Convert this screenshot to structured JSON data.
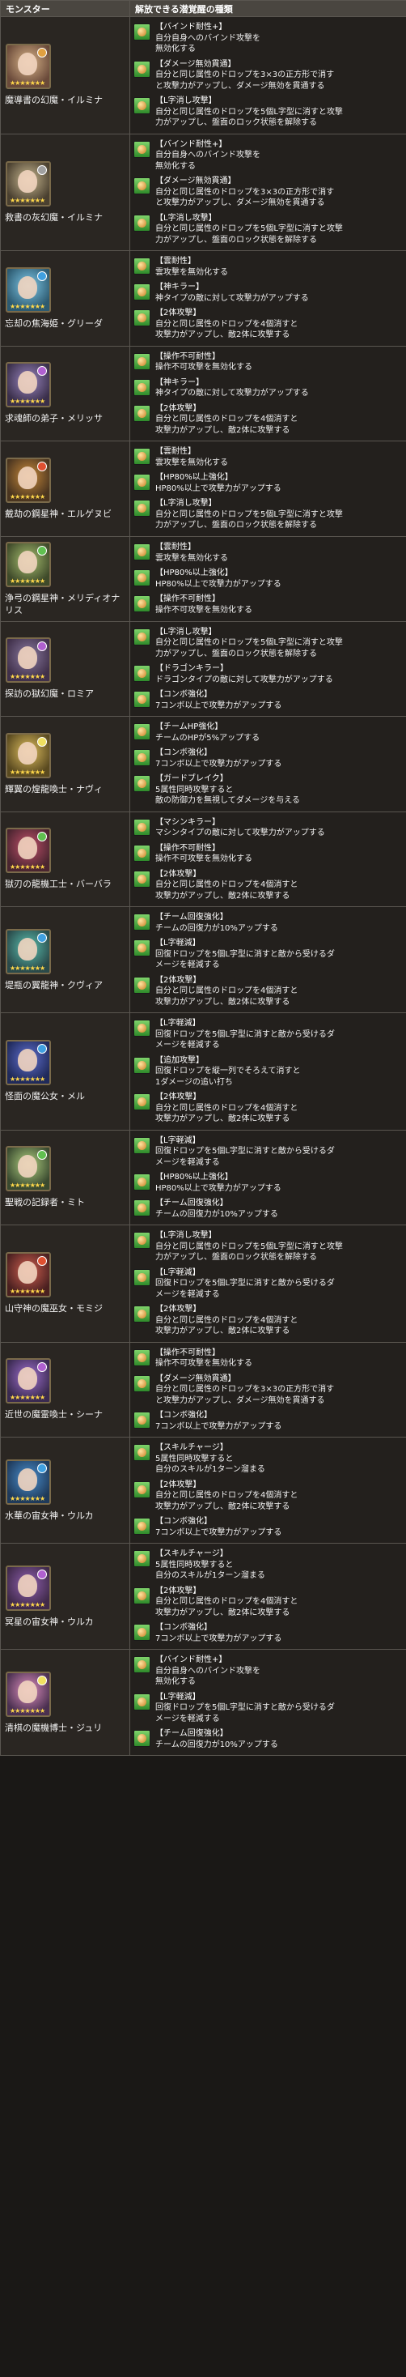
{
  "header": {
    "col_monster": "モンスター",
    "col_skills": "解放できる潜覚醒の種類"
  },
  "colors": {
    "header_bg": "#4a4640",
    "border": "#5a5650",
    "row_bg": "#23201d",
    "icon_green": "#3e9a34"
  },
  "rows": [
    {
      "name": "魔導書の幻魔・イルミナ",
      "icon": "awakening-green-icon",
      "skills": [
        {
          "title": "【バインド耐性+】",
          "lines": [
            "自分自身へのバインド攻撃を",
            "無効化する"
          ]
        },
        {
          "title": "【ダメージ無効貫通】",
          "lines": [
            "自分と同じ属性のドロップを3×3の正方形で消す",
            "と攻撃力がアップし、ダメージ無効を貫通する"
          ]
        },
        {
          "title": "【L字消し攻撃】",
          "lines": [
            "自分と同じ属性のドロップを5個L字型に消すと攻撃",
            "力がアップし、盤面のロック状態を解除する"
          ]
        }
      ]
    },
    {
      "name": "救書の灰幻魔・イルミナ",
      "icon": "awakening-green-icon",
      "skills": [
        {
          "title": "【バインド耐性+】",
          "lines": [
            "自分自身へのバインド攻撃を",
            "無効化する"
          ]
        },
        {
          "title": "【ダメージ無効貫通】",
          "lines": [
            "自分と同じ属性のドロップを3×3の正方形で消す",
            "と攻撃力がアップし、ダメージ無効を貫通する"
          ]
        },
        {
          "title": "【L字消し攻撃】",
          "lines": [
            "自分と同じ属性のドロップを5個L字型に消すと攻撃",
            "力がアップし、盤面のロック状態を解除する"
          ]
        }
      ]
    },
    {
      "name": "忘却の焦海姫・グリーダ",
      "icon": "awakening-green-icon",
      "skills": [
        {
          "title": "【雲耐性】",
          "lines": [
            "雲攻撃を無効化する"
          ]
        },
        {
          "title": "【神キラー】",
          "lines": [
            "神タイプの敵に対して攻撃力がアップする"
          ]
        },
        {
          "title": "【2体攻撃】",
          "lines": [
            "自分と同じ属性のドロップを4個消すと",
            "攻撃力がアップし、敵2体に攻撃する"
          ]
        }
      ]
    },
    {
      "name": "求魂師の弟子・メリッサ",
      "icon": "awakening-green-icon",
      "skills": [
        {
          "title": "【操作不可耐性】",
          "lines": [
            "操作不可攻撃を無効化する"
          ]
        },
        {
          "title": "【神キラー】",
          "lines": [
            "神タイプの敵に対して攻撃力がアップする"
          ]
        },
        {
          "title": "【2体攻撃】",
          "lines": [
            "自分と同じ属性のドロップを4個消すと",
            "攻撃力がアップし、敵2体に攻撃する"
          ]
        }
      ]
    },
    {
      "name": "戴劫の鋼星神・エルゲヌビ",
      "icon": "awakening-green-icon",
      "skills": [
        {
          "title": "【雲耐性】",
          "lines": [
            "雲攻撃を無効化する"
          ]
        },
        {
          "title": "【HP80%以上強化】",
          "lines": [
            "HP80%以上で攻撃力がアップする"
          ]
        },
        {
          "title": "【L字消し攻撃】",
          "lines": [
            "自分と同じ属性のドロップを5個L字型に消すと攻撃",
            "力がアップし、盤面のロック状態を解除する"
          ]
        }
      ]
    },
    {
      "name": "浄弓の鋼星神・メリディオナリス",
      "icon": "awakening-green-icon",
      "skills": [
        {
          "title": "【雲耐性】",
          "lines": [
            "雲攻撃を無効化する"
          ]
        },
        {
          "title": "【HP80%以上強化】",
          "lines": [
            "HP80%以上で攻撃力がアップする"
          ]
        },
        {
          "title": "【操作不可耐性】",
          "lines": [
            "操作不可攻撃を無効化する"
          ]
        }
      ]
    },
    {
      "name": "探訪の獄幻魔・ロミア",
      "icon": "awakening-green-icon",
      "skills": [
        {
          "title": "【L字消し攻撃】",
          "lines": [
            "自分と同じ属性のドロップを5個L字型に消すと攻撃",
            "力がアップし、盤面のロック状態を解除する"
          ]
        },
        {
          "title": "【ドラゴンキラー】",
          "lines": [
            "ドラゴンタイプの敵に対して攻撃力がアップする"
          ]
        },
        {
          "title": "【コンボ強化】",
          "lines": [
            "7コンボ以上で攻撃力がアップする"
          ]
        }
      ]
    },
    {
      "name": "輝翼の煌龍喚士・ナヴィ",
      "icon": "awakening-green-icon",
      "skills": [
        {
          "title": "【チームHP強化】",
          "lines": [
            "チームのHPが5%アップする"
          ]
        },
        {
          "title": "【コンボ強化】",
          "lines": [
            "7コンボ以上で攻撃力がアップする"
          ]
        },
        {
          "title": "【ガードブレイク】",
          "lines": [
            "5属性同時攻撃すると",
            "敵の防御力を無視してダメージを与える"
          ]
        }
      ]
    },
    {
      "name": "獄刃の龍機工士・バーバラ",
      "icon": "awakening-green-icon",
      "skills": [
        {
          "title": "【マシンキラー】",
          "lines": [
            "マシンタイプの敵に対して攻撃力がアップする"
          ]
        },
        {
          "title": "【操作不可耐性】",
          "lines": [
            "操作不可攻撃を無効化する"
          ]
        },
        {
          "title": "【2体攻撃】",
          "lines": [
            "自分と同じ属性のドロップを4個消すと",
            "攻撃力がアップし、敵2体に攻撃する"
          ]
        }
      ]
    },
    {
      "name": "堤瓶の翼龍神・クヴィア",
      "icon": "awakening-green-icon",
      "skills": [
        {
          "title": "【チーム回復強化】",
          "lines": [
            "チームの回復力が10%アップする"
          ]
        },
        {
          "title": "【L字軽減】",
          "lines": [
            "回復ドロップを5個L字型に消すと敵から受けるダ",
            "メージを軽減する"
          ]
        },
        {
          "title": "【2体攻撃】",
          "lines": [
            "自分と同じ属性のドロップを4個消すと",
            "攻撃力がアップし、敵2体に攻撃する"
          ]
        }
      ]
    },
    {
      "name": "怪面の魔公女・メル",
      "icon": "awakening-green-icon",
      "skills": [
        {
          "title": "【L字軽減】",
          "lines": [
            "回復ドロップを5個L字型に消すと敵から受けるダ",
            "メージを軽減する"
          ]
        },
        {
          "title": "【追加攻撃】",
          "lines": [
            "回復ドロップを縦一列でそろえて消すと",
            "1ダメージの追い打ち"
          ]
        },
        {
          "title": "【2体攻撃】",
          "lines": [
            "自分と同じ属性のドロップを4個消すと",
            "攻撃力がアップし、敵2体に攻撃する"
          ]
        }
      ]
    },
    {
      "name": "聖戦の記録者・ミト",
      "icon": "awakening-green-icon",
      "skills": [
        {
          "title": "【L字軽減】",
          "lines": [
            "回復ドロップを5個L字型に消すと敵から受けるダ",
            "メージを軽減する"
          ]
        },
        {
          "title": "【HP80%以上強化】",
          "lines": [
            "HP80%以上で攻撃力がアップする"
          ]
        },
        {
          "title": "【チーム回復強化】",
          "lines": [
            "チームの回復力が10%アップする"
          ]
        }
      ]
    },
    {
      "name": "山守神の魔巫女・モミジ",
      "icon": "awakening-green-icon",
      "skills": [
        {
          "title": "【L字消し攻撃】",
          "lines": [
            "自分と同じ属性のドロップを5個L字型に消すと攻撃",
            "力がアップし、盤面のロック状態を解除する"
          ]
        },
        {
          "title": "【L字軽減】",
          "lines": [
            "回復ドロップを5個L字型に消すと敵から受けるダ",
            "メージを軽減する"
          ]
        },
        {
          "title": "【2体攻撃】",
          "lines": [
            "自分と同じ属性のドロップを4個消すと",
            "攻撃力がアップし、敵2体に攻撃する"
          ]
        }
      ]
    },
    {
      "name": "近世の魔霊喚士・シーナ",
      "icon": "awakening-green-icon",
      "skills": [
        {
          "title": "【操作不可耐性】",
          "lines": [
            "操作不可攻撃を無効化する"
          ]
        },
        {
          "title": "【ダメージ無効貫通】",
          "lines": [
            "自分と同じ属性のドロップを3×3の正方形で消す",
            "と攻撃力がアップし、ダメージ無効を貫通する"
          ]
        },
        {
          "title": "【コンボ強化】",
          "lines": [
            "7コンボ以上で攻撃力がアップする"
          ]
        }
      ]
    },
    {
      "name": "水華の宙女神・ウルカ",
      "icon": "awakening-green-icon",
      "skills": [
        {
          "title": "【スキルチャージ】",
          "lines": [
            "5属性同時攻撃すると",
            "自分のスキルが1ターン溜まる"
          ]
        },
        {
          "title": "【2体攻撃】",
          "lines": [
            "自分と同じ属性のドロップを4個消すと",
            "攻撃力がアップし、敵2体に攻撃する"
          ]
        },
        {
          "title": "【コンボ強化】",
          "lines": [
            "7コンボ以上で攻撃力がアップする"
          ]
        }
      ]
    },
    {
      "name": "冥星の宙女神・ウルカ",
      "icon": "awakening-green-icon",
      "skills": [
        {
          "title": "【スキルチャージ】",
          "lines": [
            "5属性同時攻撃すると",
            "自分のスキルが1ターン溜まる"
          ]
        },
        {
          "title": "【2体攻撃】",
          "lines": [
            "自分と同じ属性のドロップを4個消すと",
            "攻撃力がアップし、敵2体に攻撃する"
          ]
        },
        {
          "title": "【コンボ強化】",
          "lines": [
            "7コンボ以上で攻撃力がアップする"
          ]
        }
      ]
    },
    {
      "name": "清棋の魔機博士・ジュリ",
      "icon": "awakening-green-icon",
      "skills": [
        {
          "title": "【バインド耐性+】",
          "lines": [
            "自分自身へのバインド攻撃を",
            "無効化する"
          ]
        },
        {
          "title": "【L字軽減】",
          "lines": [
            "回復ドロップを5個L字型に消すと敵から受けるダ",
            "メージを軽減する"
          ]
        },
        {
          "title": "【チーム回復強化】",
          "lines": [
            "チームの回復力が10%アップする"
          ]
        }
      ]
    }
  ]
}
